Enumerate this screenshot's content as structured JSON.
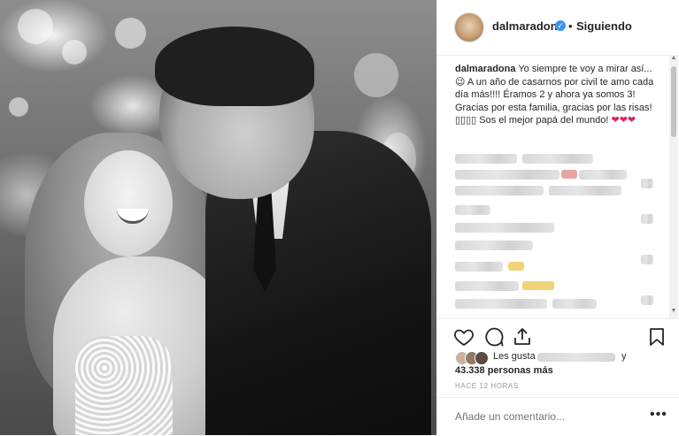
{
  "post": {
    "username": "dalmaradona",
    "verified_mark": "✓",
    "separator": "•",
    "follow_status": "Siguiendo",
    "caption_user": "dalmaradona",
    "caption_text": "Yo siempre te voy a mirar así... 😉 A un año de casarnos por civil te amo cada día más!!!! Éramos 2 y ahora ya somos 3! Gracias por esta familia, gracias por las risas! ▯▯▯▯ Sos el mejor papá del mundo!",
    "caption_hearts": "❤❤❤",
    "likes_prefix": "Les gusta a",
    "likes_conj": "y",
    "likes_count": "43.338 personas más",
    "timestamp": "HACE 12 HORAS",
    "comment_placeholder": "Añade un comentario...",
    "more_label": "•••"
  },
  "icons": {
    "like": "heart-icon",
    "comment": "comment-icon",
    "share": "share-icon",
    "save": "bookmark-icon",
    "verified": "verified-badge-icon"
  },
  "colors": {
    "verified": "#3897f0",
    "hearts": "#e0245e",
    "border": "#efefef",
    "muted": "#999999"
  }
}
